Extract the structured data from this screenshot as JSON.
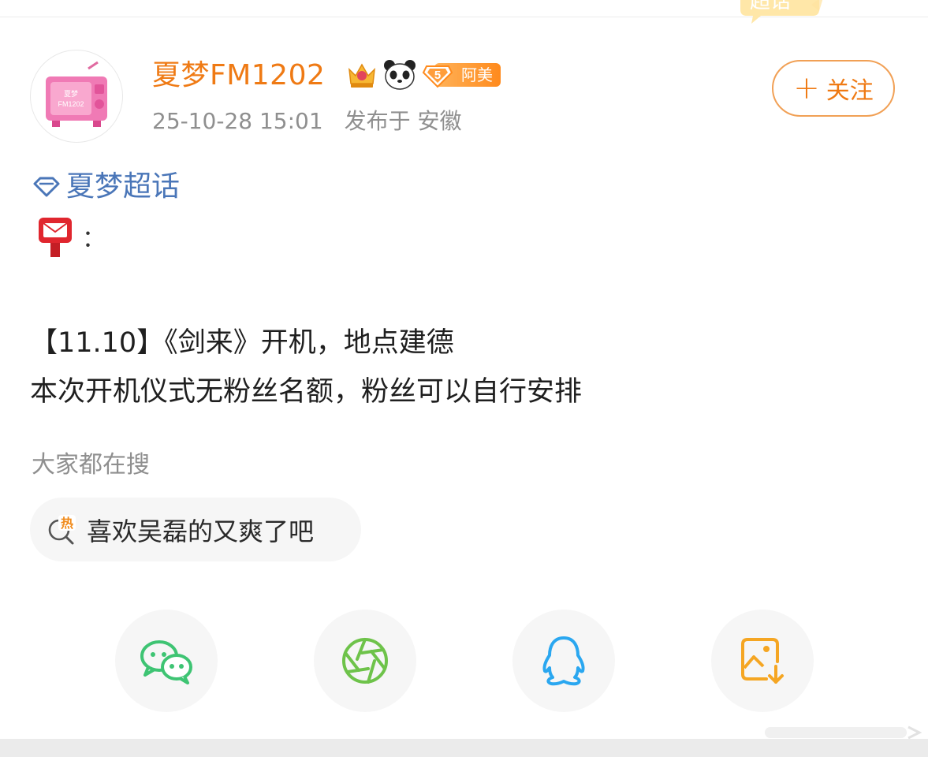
{
  "post": {
    "username": "夏梦FM1202",
    "level_number": "5",
    "level_label": "阿美",
    "timestamp": "25-10-28 15:01",
    "published_in": "发布于 安徽",
    "follow_label": "关注",
    "avatar_caption_top": "夏梦",
    "avatar_caption_bottom": "FM1202",
    "topic_label": "夏梦超话",
    "emoji_suffix": "：",
    "body_lines": [
      "【11.10】《剑来》开机，地点建德",
      "本次开机仪式无粉丝名额，粉丝可以自行安排"
    ]
  },
  "search": {
    "caption": "大家都在搜",
    "hot_badge": "热",
    "hot_query": "喜欢吴磊的又爽了吧"
  },
  "top_badge_text": "超话",
  "share_buttons": [
    {
      "icon": "wechat-icon",
      "color": "#3ec473"
    },
    {
      "icon": "moments-icon",
      "color": "#6ec34a"
    },
    {
      "icon": "qq-icon",
      "color": "#2aa7f0"
    },
    {
      "icon": "save-image-icon",
      "color": "#f5a623"
    }
  ],
  "colors": {
    "username": "#ef7a14",
    "topic": "#4a76b8",
    "meta": "#8f8f8f",
    "follow_border": "#f1a055"
  }
}
